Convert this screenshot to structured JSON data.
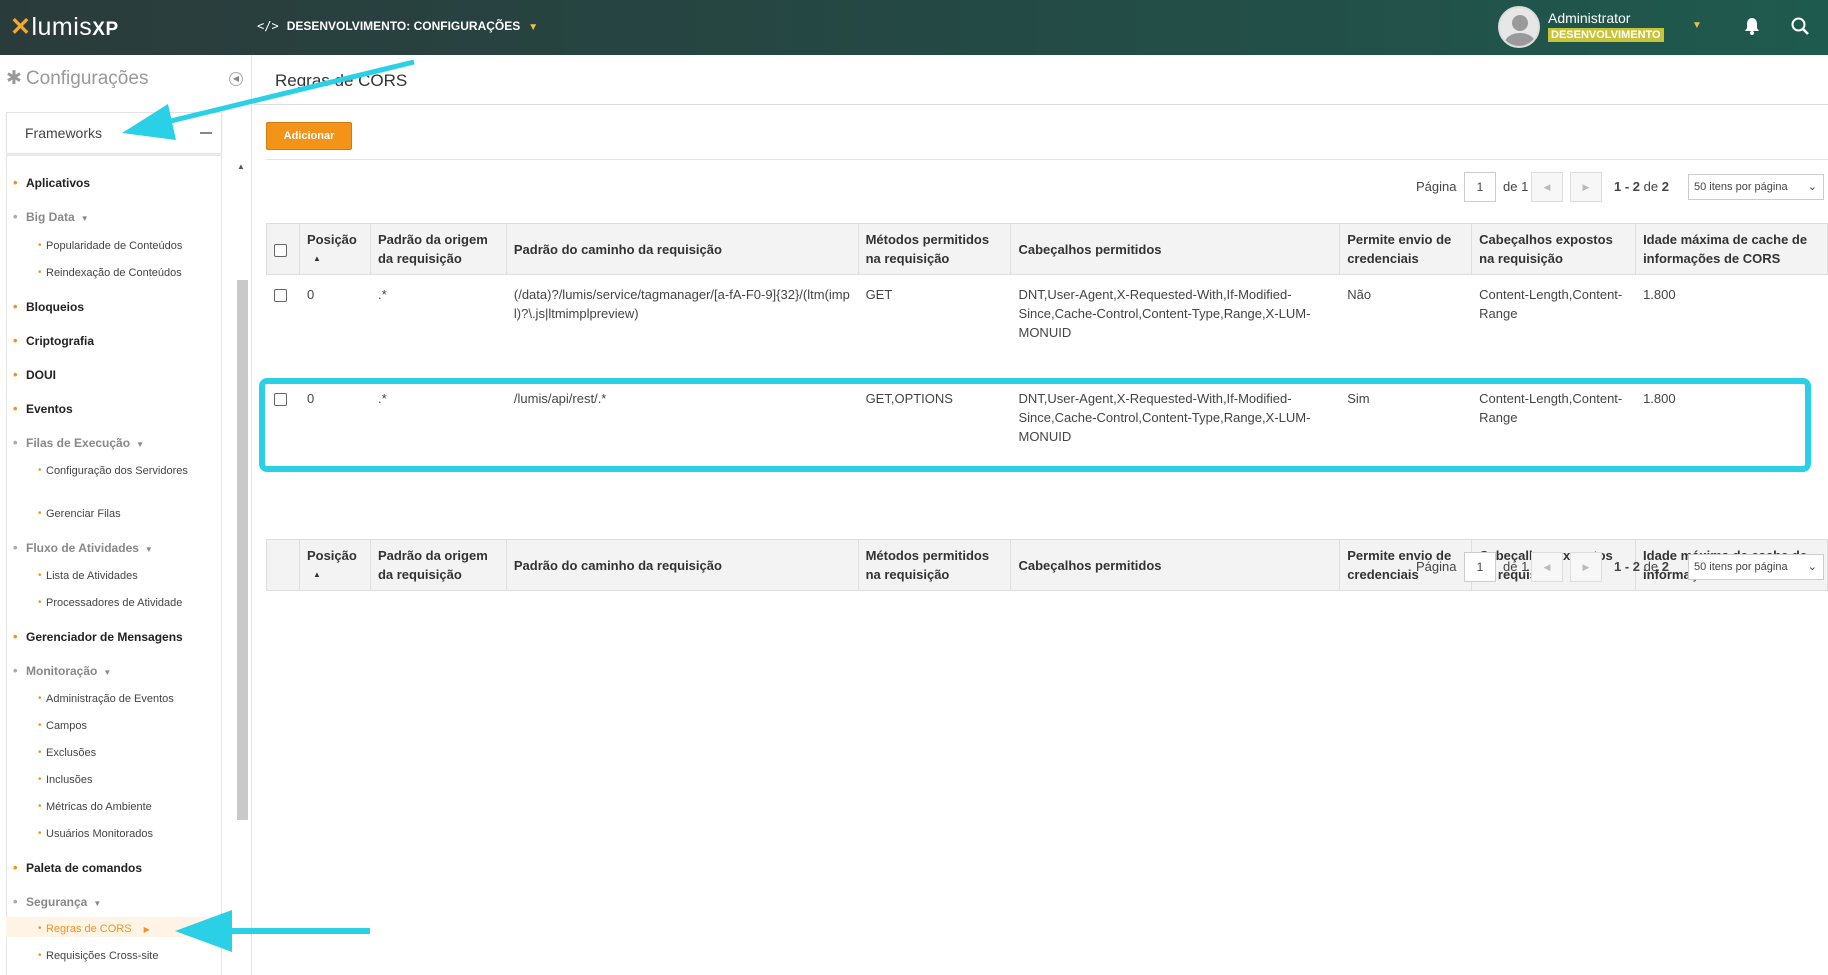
{
  "topbar": {
    "logo_main": "lumis",
    "logo_xp": "XP",
    "code_glyph": "</>",
    "breadcrumb": "DESENVOLVIMENTO: CONFIGURAÇÕES",
    "user_name": "Administrator",
    "user_env": "DESENVOLVIMENTO"
  },
  "sidebar": {
    "title": "Configurações",
    "section": "Frameworks",
    "items": [
      {
        "label": "Aplicativos"
      },
      {
        "label": "Big Data"
      },
      {
        "label": "Popularidade de Conteúdos"
      },
      {
        "label": "Reindexação de Conteúdos"
      },
      {
        "label": "Bloqueios"
      },
      {
        "label": "Criptografia"
      },
      {
        "label": "DOUI"
      },
      {
        "label": "Eventos"
      },
      {
        "label": "Filas de Execução"
      },
      {
        "label": "Configuração dos Servidores"
      },
      {
        "label": "Gerenciar Filas"
      },
      {
        "label": "Fluxo de Atividades"
      },
      {
        "label": "Lista de Atividades"
      },
      {
        "label": "Processadores de Atividade"
      },
      {
        "label": "Gerenciador de Mensagens"
      },
      {
        "label": "Monitoração"
      },
      {
        "label": "Administração de Eventos"
      },
      {
        "label": "Campos"
      },
      {
        "label": "Exclusões"
      },
      {
        "label": "Inclusões"
      },
      {
        "label": "Métricas do Ambiente"
      },
      {
        "label": "Usuários Monitorados"
      },
      {
        "label": "Paleta de comandos"
      },
      {
        "label": "Segurança"
      },
      {
        "label": "Regras de CORS"
      },
      {
        "label": "Requisições Cross-site"
      }
    ]
  },
  "main": {
    "page_title": "Regras de CORS",
    "add_label": "Adicionar",
    "pager": {
      "page_label": "Página",
      "page_value": "1",
      "of_label": "de 1",
      "range": "1 - 2",
      "range_of": "de",
      "total": "2",
      "per_page": "50 itens por página"
    },
    "columns": [
      "Posição",
      "Padrão da origem da requisição",
      "Padrão do caminho da requisição",
      "Métodos permitidos na requisição",
      "Cabeçalhos permitidos",
      "Permite envio de credenciais",
      "Cabeçalhos expostos na requisição",
      "Idade máxima de cache de informações de CORS"
    ],
    "rows": [
      {
        "position": "0",
        "origin": ".*",
        "path": "(/data)?/lumis/service/tagmanager/[a-fA-F0-9]{32}/(ltm(impl)?\\.js|ltmimplpreview)",
        "methods": "GET",
        "headers": "DNT,User-Agent,X-Requested-With,If-Modified-Since,Cache-Control,Content-Type,Range,X-LUM-MONUID",
        "credentials": "Não",
        "exposed": "Content-Length,Content-Range",
        "max_age": "1.800"
      },
      {
        "position": "0",
        "origin": ".*",
        "path": "/lumis/api/rest/.*",
        "methods": "GET,OPTIONS",
        "headers": "DNT,User-Agent,X-Requested-With,If-Modified-Since,Cache-Control,Content-Type,Range,X-LUM-MONUID",
        "credentials": "Sim",
        "exposed": "Content-Length,Content-Range",
        "max_age": "1.800"
      }
    ]
  },
  "colors": {
    "accent": "#f39318",
    "highlight": "#29d0e6",
    "topbar": "#244a45"
  }
}
